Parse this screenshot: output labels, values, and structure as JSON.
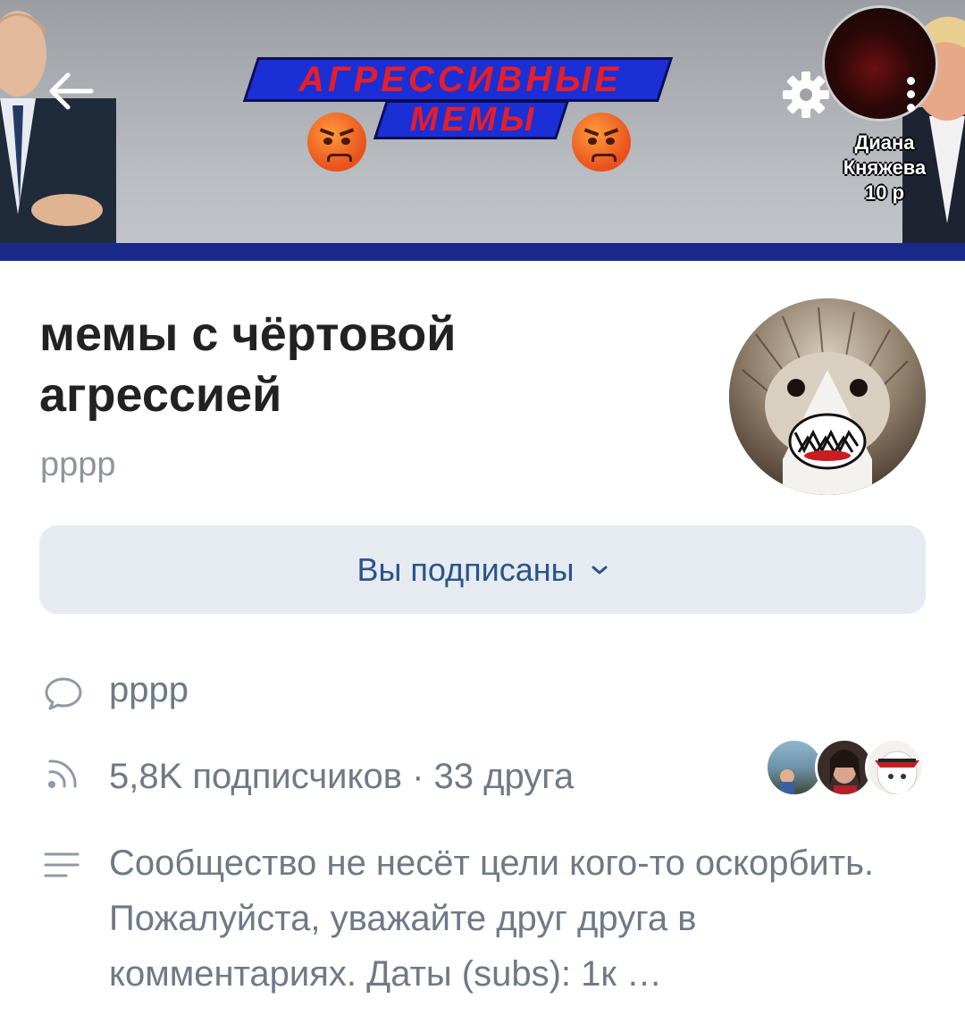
{
  "cover": {
    "banner_line1": "АГРЕССИВНЫЕ",
    "banner_line2": "МЕМЫ",
    "watermark": {
      "line1": "Диана",
      "line2": "Княжева",
      "line3": "10 р"
    },
    "stripe_color": "#1b2a8a",
    "banner_color": "#1b2fd6",
    "banner_text_color": "#e61e2a"
  },
  "toolbar": {
    "back_icon": "arrow-left-icon",
    "settings_icon": "gear-icon",
    "menu_icon": "more-vertical-icon"
  },
  "community": {
    "title": "мемы с чёртовой агрессией",
    "status": "рррр",
    "avatar": "hedgehog-with-paper-teeth"
  },
  "subscribe_button": {
    "label": "Вы подписаны",
    "icon": "chevron-down-icon",
    "bg_color": "#e6ebf2",
    "text_color": "#2a5489"
  },
  "info": {
    "status_icon": "speech-bubble-icon",
    "status_text": "рррр",
    "followers_icon": "rss-icon",
    "followers_text": "5,8K подписчиков · 33 друга",
    "description_icon": "text-lines-icon",
    "description": "Сообщество не несёт цели кого-то оскорбить. Пожалуйста, уважайте друг друга в комментариях.  Даты (subs): 1к …"
  },
  "friends": [
    {
      "name": "friend-avatar-1"
    },
    {
      "name": "friend-avatar-2"
    },
    {
      "name": "friend-avatar-3"
    }
  ]
}
